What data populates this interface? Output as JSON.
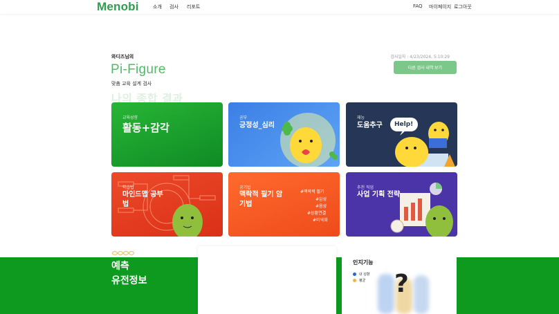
{
  "nav": {
    "logo": "Menobi",
    "links_left": [
      "소개",
      "검사",
      "리포트"
    ],
    "links_right": [
      "FAQ",
      "마이페이지",
      "로그아웃"
    ]
  },
  "hero": {
    "user_line": "와디즈님의",
    "title": "Pi-Figure",
    "subtitle": "맞춤 교육 설계 검사",
    "ghost_heading": "나의 종합 결과",
    "date": "검사일자 : 4/23/2024, 5:10:29",
    "history_button": "다른 검사 내역 보기"
  },
  "cards": [
    {
      "tag": "교육성향",
      "head": "활동+감각"
    },
    {
      "tag": "공부",
      "head": "긍정성_심리"
    },
    {
      "tag": "재능",
      "head": "도움추구"
    },
    {
      "tag": "학습법",
      "head": "마인드맵 공부\n법"
    },
    {
      "tag": "공기법",
      "head": "맥락적 필기 암\n기법"
    },
    {
      "tag": "추천 직업",
      "head": "사업 기획 전략"
    }
  ],
  "card_extras": {
    "help_bubble": "Help!",
    "hashtags": [
      "#맥락적 필기",
      "#암성",
      "#음성",
      "#상황연결",
      "#미덕화"
    ]
  },
  "band": {
    "title1": "예측",
    "title2": "유전정보"
  },
  "cognitive": {
    "title": "인지기능",
    "legend": [
      {
        "label": "내 성향",
        "color": "#2e63d9"
      },
      {
        "label": "평균",
        "color": "#f2b544"
      }
    ],
    "placeholder": "?"
  },
  "colors": {
    "brand": "#2d9e4a",
    "band": "#0d9a1f",
    "button": "#7cc88a"
  }
}
